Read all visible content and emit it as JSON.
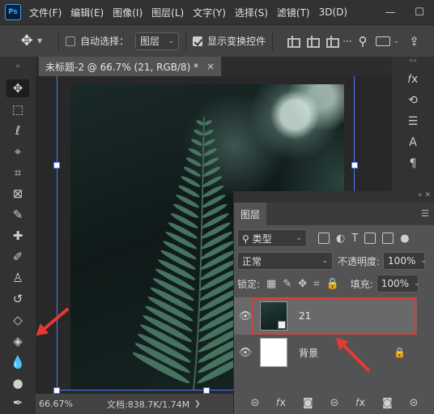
{
  "app": {
    "logo": "Ps"
  },
  "menu": [
    "文件(F)",
    "编辑(E)",
    "图像(I)",
    "图层(L)",
    "文字(Y)",
    "选择(S)",
    "滤镜(T)",
    "3D(D)"
  ],
  "window_controls": {
    "minimize": "—",
    "maximize": "☐"
  },
  "options": {
    "auto_select_label": "自动选择：",
    "auto_select_checked": false,
    "auto_select_target": "图层",
    "show_transform_label": "显示变换控件",
    "show_transform_checked": true
  },
  "document": {
    "tab_title": "未标题-2 @ 66.7% (21, RGB/8) *",
    "close": "×"
  },
  "status": {
    "zoom": "66.67%",
    "doc_size": "文档:838.7K/1.74M"
  },
  "layers_panel": {
    "title": "图层",
    "filter_kind": "类型",
    "blend_mode": "正常",
    "opacity_label": "不透明度:",
    "opacity_value": "100%",
    "lock_label": "锁定:",
    "fill_label": "填充:",
    "fill_value": "100%",
    "layers": [
      {
        "name": "21",
        "selected": true,
        "visible": true
      },
      {
        "name": "背景",
        "locked": true,
        "visible": true
      }
    ]
  },
  "annotation_color": "#e53935"
}
